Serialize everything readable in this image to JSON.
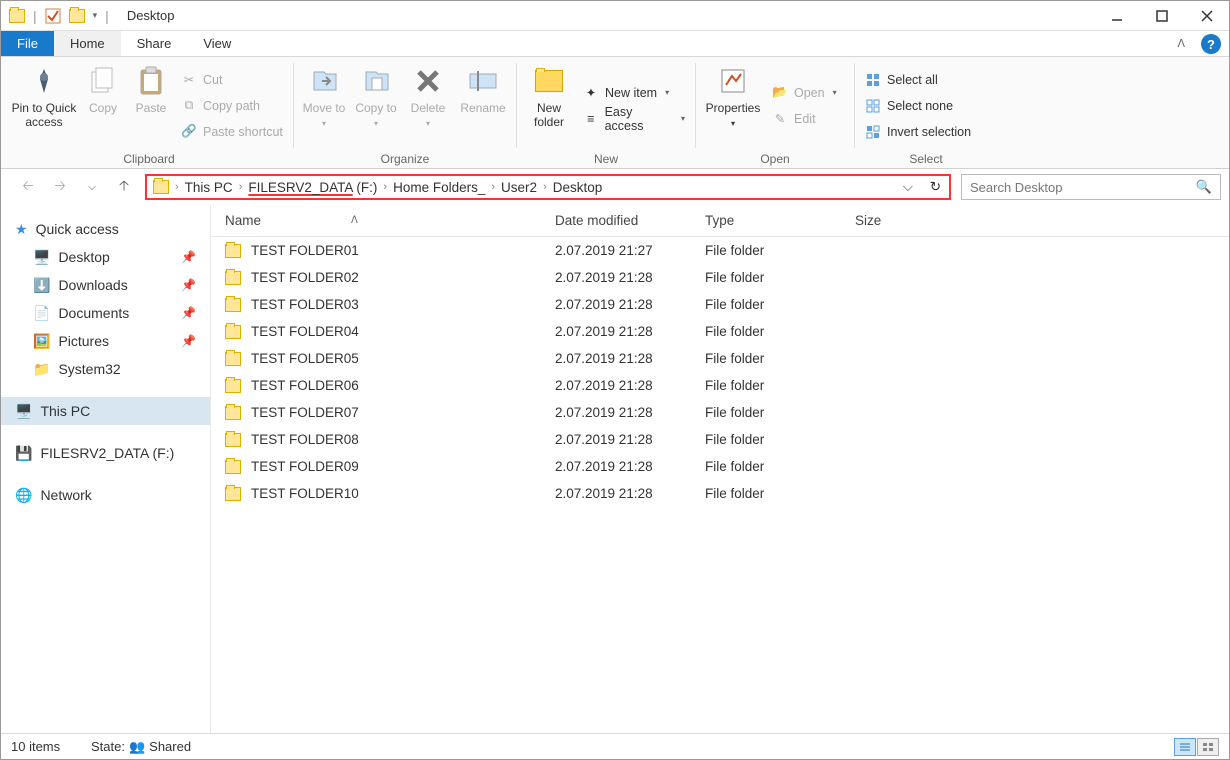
{
  "window": {
    "title": "Desktop"
  },
  "tabs": {
    "file": "File",
    "home": "Home",
    "share": "Share",
    "view": "View"
  },
  "ribbon": {
    "clipboard": {
      "pin": "Pin to Quick access",
      "copy": "Copy",
      "paste": "Paste",
      "cut": "Cut",
      "copypath": "Copy path",
      "pastesc": "Paste shortcut",
      "label": "Clipboard"
    },
    "organize": {
      "moveto": "Move to",
      "copyto": "Copy to",
      "delete": "Delete",
      "rename": "Rename",
      "label": "Organize"
    },
    "new": {
      "newfolder": "New folder",
      "newitem": "New item",
      "easyaccess": "Easy access",
      "label": "New"
    },
    "open": {
      "properties": "Properties",
      "open": "Open",
      "edit": "Edit",
      "label": "Open"
    },
    "select": {
      "selectall": "Select all",
      "selectnone": "Select none",
      "invert": "Invert selection",
      "label": "Select"
    }
  },
  "breadcrumb": [
    "This PC",
    "FILESRV2_DATA (F:)",
    "Home Folders_",
    "User2",
    "Desktop"
  ],
  "breadcrumb_highlight": "FILESRV2_DATA",
  "search_placeholder": "Search Desktop",
  "sidebar": {
    "quickaccess": "Quick access",
    "items": [
      {
        "label": "Desktop",
        "pinned": true
      },
      {
        "label": "Downloads",
        "pinned": true
      },
      {
        "label": "Documents",
        "pinned": true
      },
      {
        "label": "Pictures",
        "pinned": true
      },
      {
        "label": "System32",
        "pinned": false
      }
    ],
    "thispc": "This PC",
    "drive": "FILESRV2_DATA (F:)",
    "network": "Network"
  },
  "columns": {
    "name": "Name",
    "date": "Date modified",
    "type": "Type",
    "size": "Size"
  },
  "rows": [
    {
      "name": "TEST FOLDER01",
      "date": "2.07.2019 21:27",
      "type": "File folder"
    },
    {
      "name": "TEST FOLDER02",
      "date": "2.07.2019 21:28",
      "type": "File folder"
    },
    {
      "name": "TEST FOLDER03",
      "date": "2.07.2019 21:28",
      "type": "File folder"
    },
    {
      "name": "TEST FOLDER04",
      "date": "2.07.2019 21:28",
      "type": "File folder"
    },
    {
      "name": "TEST FOLDER05",
      "date": "2.07.2019 21:28",
      "type": "File folder"
    },
    {
      "name": "TEST FOLDER06",
      "date": "2.07.2019 21:28",
      "type": "File folder"
    },
    {
      "name": "TEST FOLDER07",
      "date": "2.07.2019 21:28",
      "type": "File folder"
    },
    {
      "name": "TEST FOLDER08",
      "date": "2.07.2019 21:28",
      "type": "File folder"
    },
    {
      "name": "TEST FOLDER09",
      "date": "2.07.2019 21:28",
      "type": "File folder"
    },
    {
      "name": "TEST FOLDER10",
      "date": "2.07.2019 21:28",
      "type": "File folder"
    }
  ],
  "status": {
    "count": "10 items",
    "state_label": "State:",
    "state": "Shared"
  }
}
